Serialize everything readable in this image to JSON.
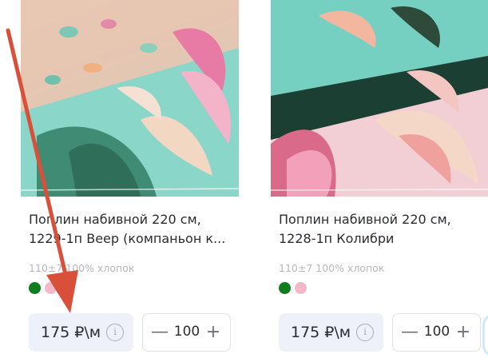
{
  "products": [
    {
      "title_line1": "Поплин набивной 220 см,",
      "title_line2": "1229-1п Веер (компаньон к...",
      "spec": "110±7 100% хлопок",
      "colors": [
        "#0f7f1d",
        "#f5b8c9"
      ],
      "price": "175 ₽\\м",
      "quantity": "100",
      "minus_label": "—",
      "plus_label": "+",
      "info_label": "i"
    },
    {
      "title_line1": "Поплин набивной 220 см,",
      "title_line2": "1228-1п Колибри",
      "spec": "110±7 100% хлопок",
      "colors": [
        "#0f7f1d",
        "#f5b8c9"
      ],
      "price": "175 ₽\\м",
      "quantity": "100",
      "minus_label": "—",
      "plus_label": "+",
      "info_label": "i"
    }
  ],
  "annotation": {
    "arrow_color": "#d9503a"
  }
}
